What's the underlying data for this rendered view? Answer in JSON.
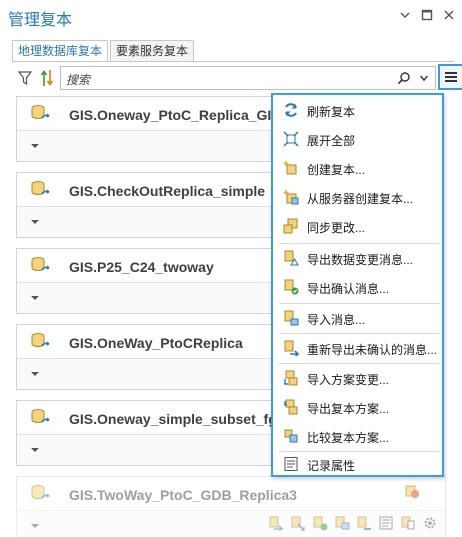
{
  "window": {
    "title": "管理复本"
  },
  "tabs": [
    {
      "label": "地理数据库复本",
      "active": true
    },
    {
      "label": "要素服务复本",
      "active": false
    }
  ],
  "search": {
    "placeholder": "搜索"
  },
  "replicas": [
    {
      "name": "GIS.Oneway_PtoC_Replica_GIS"
    },
    {
      "name": "GIS.CheckOutReplica_simple"
    },
    {
      "name": "GIS.P25_C24_twoway"
    },
    {
      "name": "GIS.OneWay_PtoCReplica"
    },
    {
      "name": "GIS.Oneway_simple_subset_fgd"
    },
    {
      "name": "GIS.TwoWay_PtoC_GDB_Replica3"
    }
  ],
  "menu": {
    "items": [
      {
        "label": "刷新复本",
        "icon": "refresh-icon"
      },
      {
        "label": "展开全部",
        "icon": "expand-all-icon"
      },
      {
        "label": "创建复本...",
        "icon": "create-replica-icon"
      },
      {
        "label": "从服务器创建复本...",
        "icon": "create-from-server-icon"
      },
      {
        "label": "同步更改...",
        "icon": "synchronize-icon"
      },
      {
        "label": "导出数据变更消息...",
        "icon": "export-data-changes-icon"
      },
      {
        "label": "导出确认消息...",
        "icon": "export-ack-icon"
      },
      {
        "label": "导入消息...",
        "icon": "import-message-icon"
      },
      {
        "label": "重新导出未确认的消息...",
        "icon": "reexport-unack-icon"
      },
      {
        "label": "导入方案变更...",
        "icon": "import-schema-icon"
      },
      {
        "label": "导出复本方案...",
        "icon": "export-schema-icon"
      },
      {
        "label": "比较复本方案...",
        "icon": "compare-schema-icon"
      },
      {
        "label": "记录属性",
        "icon": "log-properties-icon"
      }
    ]
  },
  "colors": {
    "accent": "#3aa1d8",
    "title": "#2b79b5",
    "icon_blue": "#2b79b5",
    "icon_yellow": "#e8b83a"
  }
}
